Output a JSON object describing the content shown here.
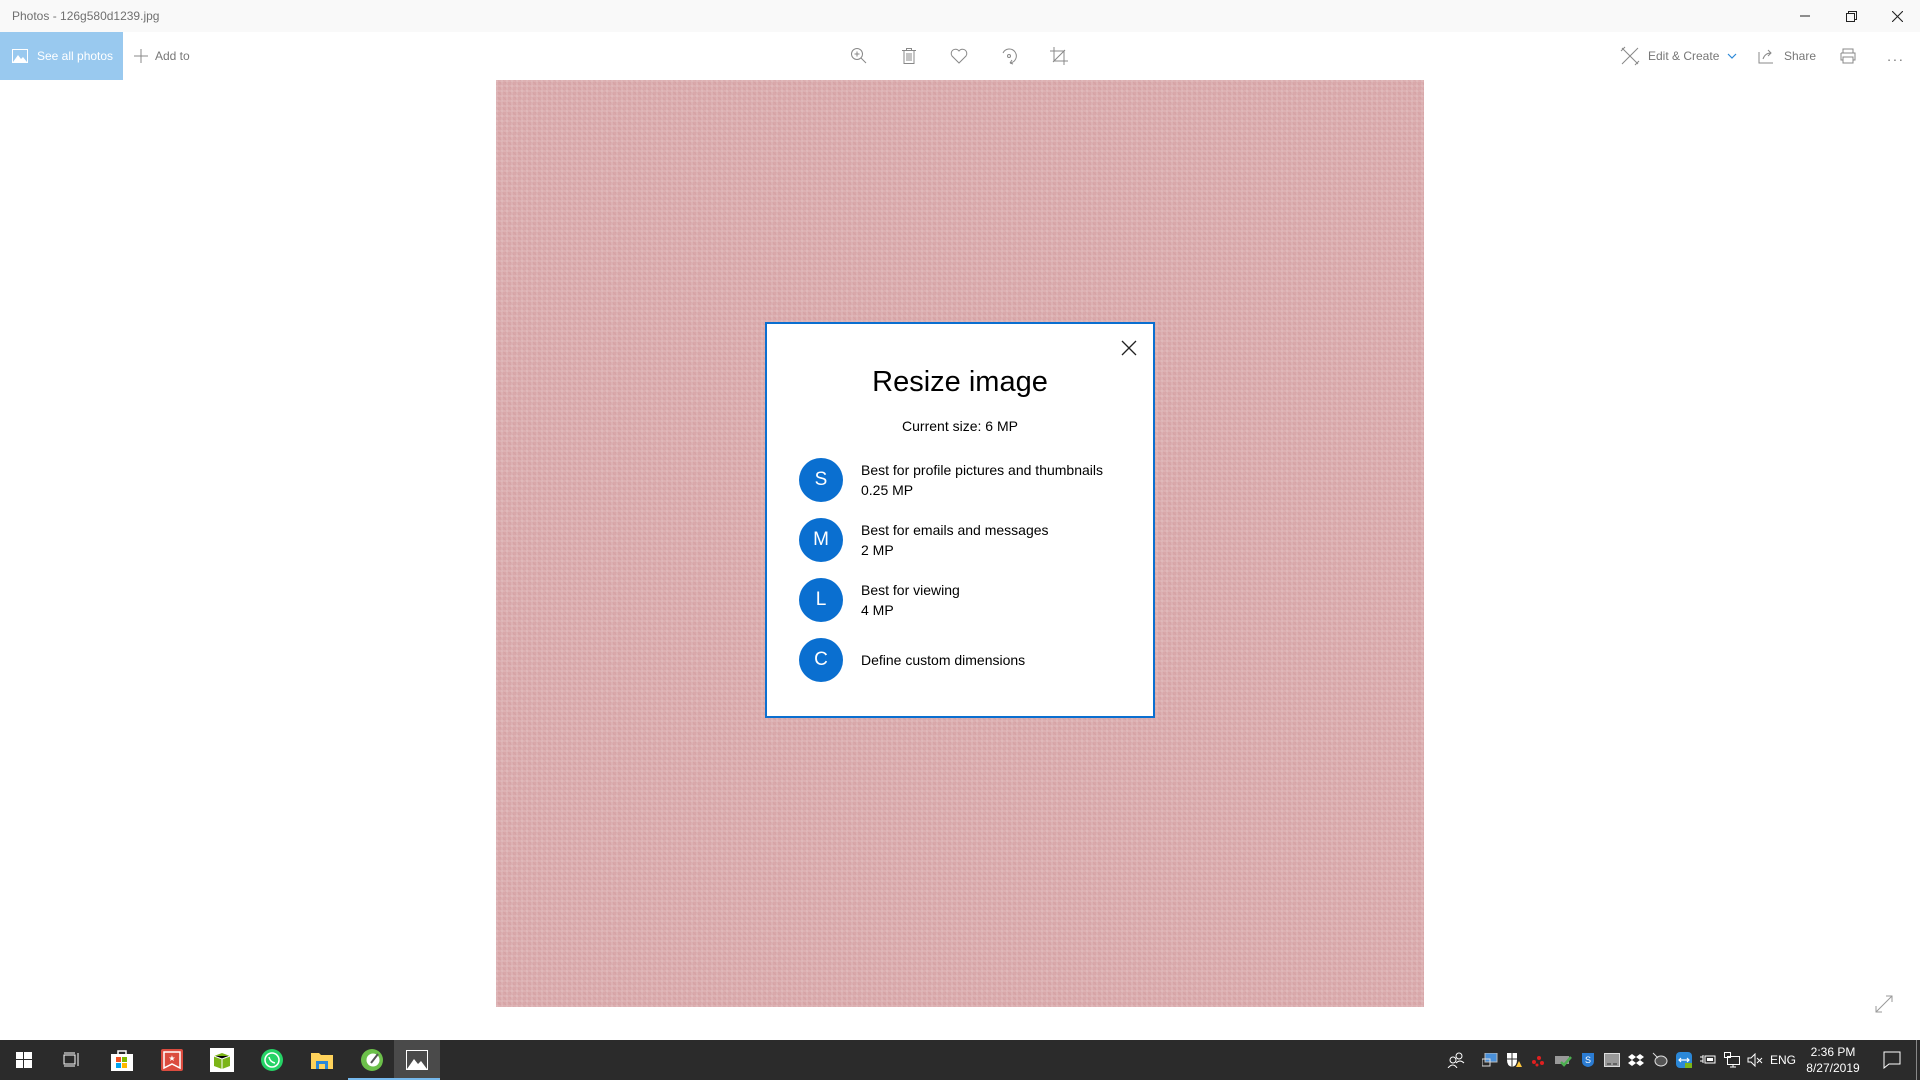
{
  "window": {
    "title": "Photos - 126g580d1239.jpg",
    "controls": [
      "minimize",
      "restore",
      "close"
    ]
  },
  "toolbar": {
    "see_all_photos": "See all photos",
    "add_to": "Add to",
    "center_icons": [
      "zoom-in-icon",
      "delete-icon",
      "favorite-icon",
      "rotate-icon",
      "crop-icon"
    ],
    "edit_create": "Edit & Create",
    "share": "Share",
    "more": "..."
  },
  "dialog": {
    "title": "Resize image",
    "current_size": "Current size: 6 MP",
    "options": [
      {
        "letter": "S",
        "label": "Best for profile pictures and thumbnails",
        "size": "0.25 MP"
      },
      {
        "letter": "M",
        "label": "Best for emails and messages",
        "size": "2 MP"
      },
      {
        "letter": "L",
        "label": "Best for viewing",
        "size": "4 MP"
      },
      {
        "letter": "C",
        "label": "Define custom dimensions",
        "size": ""
      }
    ],
    "accent_color": "#0a6fd0"
  },
  "taskbar": {
    "apps": [
      "start",
      "task-view",
      "microsoft-store",
      "wunderlist",
      "app-green-box",
      "whatsapp",
      "file-explorer",
      "app-green-circle",
      "photos"
    ],
    "active_app": "photos",
    "tray": {
      "language": "ENG",
      "time": "2:36 PM",
      "date": "8/27/2019"
    }
  }
}
